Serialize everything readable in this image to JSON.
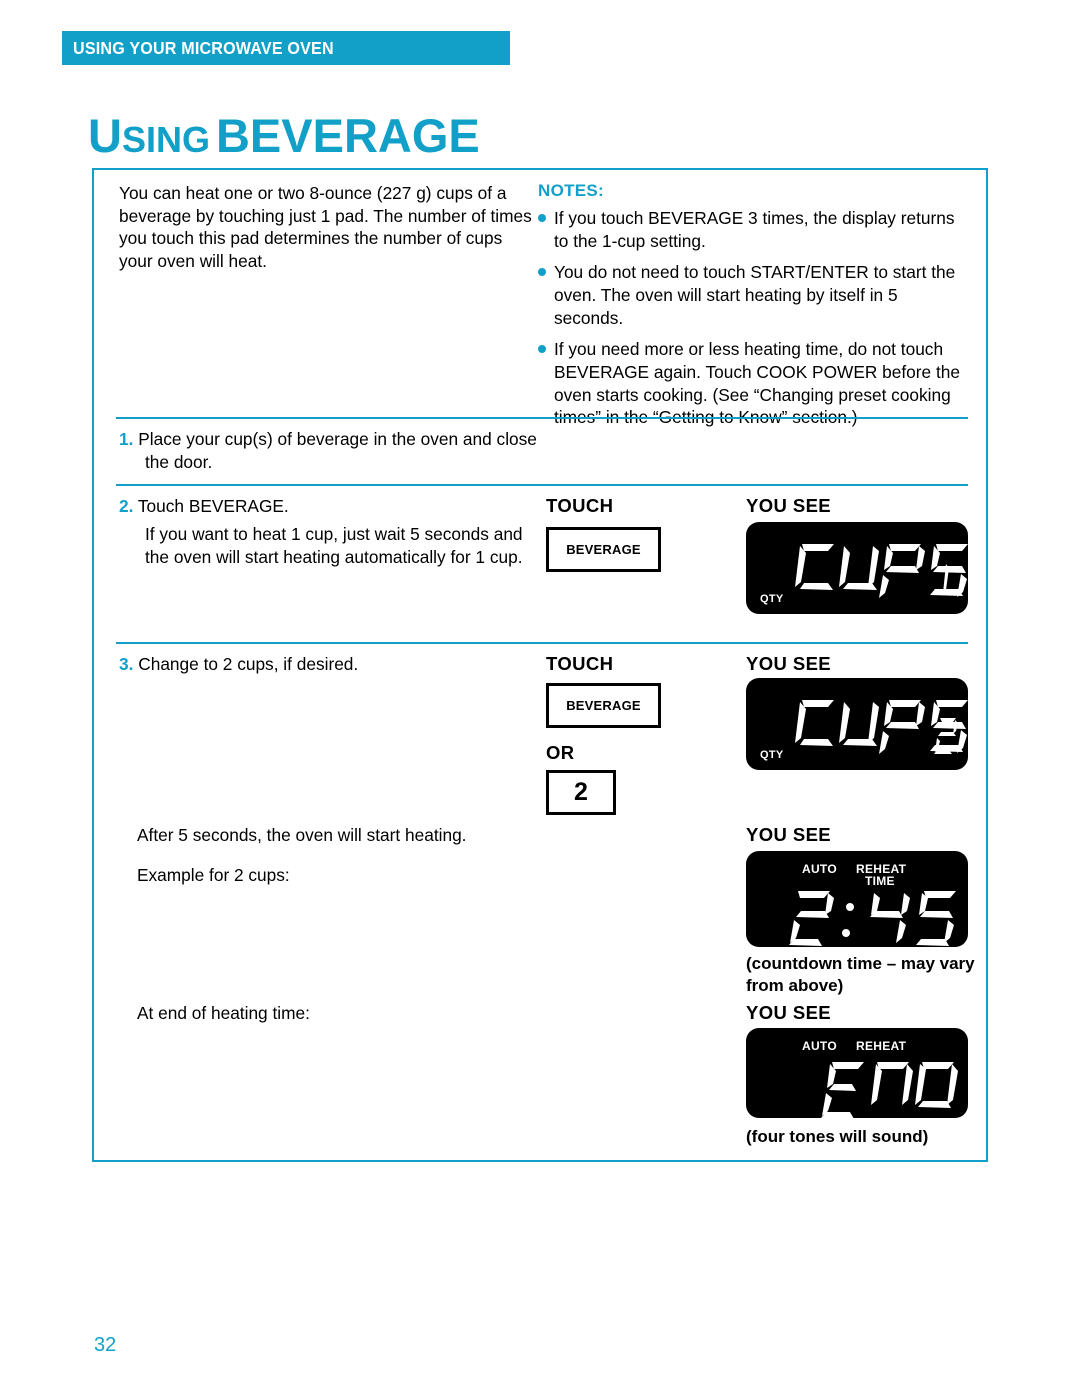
{
  "running_header": "USING YOUR MICROWAVE OVEN",
  "page_title": {
    "word1_cap": "U",
    "word1_rest": "SING",
    "word2": "BEVERAGE",
    "full": "USING BEVERAGE"
  },
  "colors": {
    "accent": "#12A0C8",
    "display_background": "#000000",
    "display_segment": "#FFFFFF",
    "text": "#000000"
  },
  "intro": "You can heat one or two 8-ounce (227 g) cups of a beverage by touching just 1 pad. The number of times you touch this pad determines the number of cups your oven will heat.",
  "notes": {
    "title": "NOTES:",
    "items": [
      "If you touch BEVERAGE 3 times, the display returns to the 1-cup setting.",
      "You do not need to touch START/ENTER to start the oven. The oven will start heating by itself in 5 seconds.",
      "If you need more or less heating time, do not touch BEVERAGE again. Touch COOK POWER before the oven starts cooking. (See “Changing preset cooking times” in the “Getting to Know” section.)"
    ]
  },
  "steps": [
    {
      "number": "1.",
      "text": "Place your cup(s) of beverage in the oven and close the door."
    },
    {
      "number": "2.",
      "text": "Touch BEVERAGE.",
      "sub": "If you want to heat 1 cup, just wait 5 seconds and the oven will start heating automatically for 1 cup."
    },
    {
      "number": "3.",
      "text": "Change to 2 cups, if desired."
    }
  ],
  "paragraphs": {
    "after_five_seconds": "After 5 seconds, the oven will start heating.",
    "example_for_two": "Example for 2 cups:",
    "at_end_of_heating": "At end of heating time:"
  },
  "columns": {
    "touch": "TOUCH",
    "you_see": "YOU SEE",
    "or": "OR"
  },
  "keys": {
    "beverage": "BEVERAGE",
    "two": "2"
  },
  "displays": [
    {
      "id": "cups-1",
      "main_text": "CUPS",
      "qty_digit": "1",
      "indicators": [
        "QTY"
      ],
      "caption": ""
    },
    {
      "id": "cups-2",
      "main_text": "CUPS",
      "qty_digit": "2",
      "indicators": [
        "QTY"
      ],
      "caption": ""
    },
    {
      "id": "countdown",
      "main_text": "2:45",
      "indicators": [
        "AUTO",
        "REHEAT",
        "TIME"
      ],
      "caption": "(countdown time – may vary from above)"
    },
    {
      "id": "end",
      "main_text": "END",
      "indicators": [
        "AUTO",
        "REHEAT"
      ],
      "caption": "(four tones will sound)"
    }
  ],
  "page_number": "32"
}
